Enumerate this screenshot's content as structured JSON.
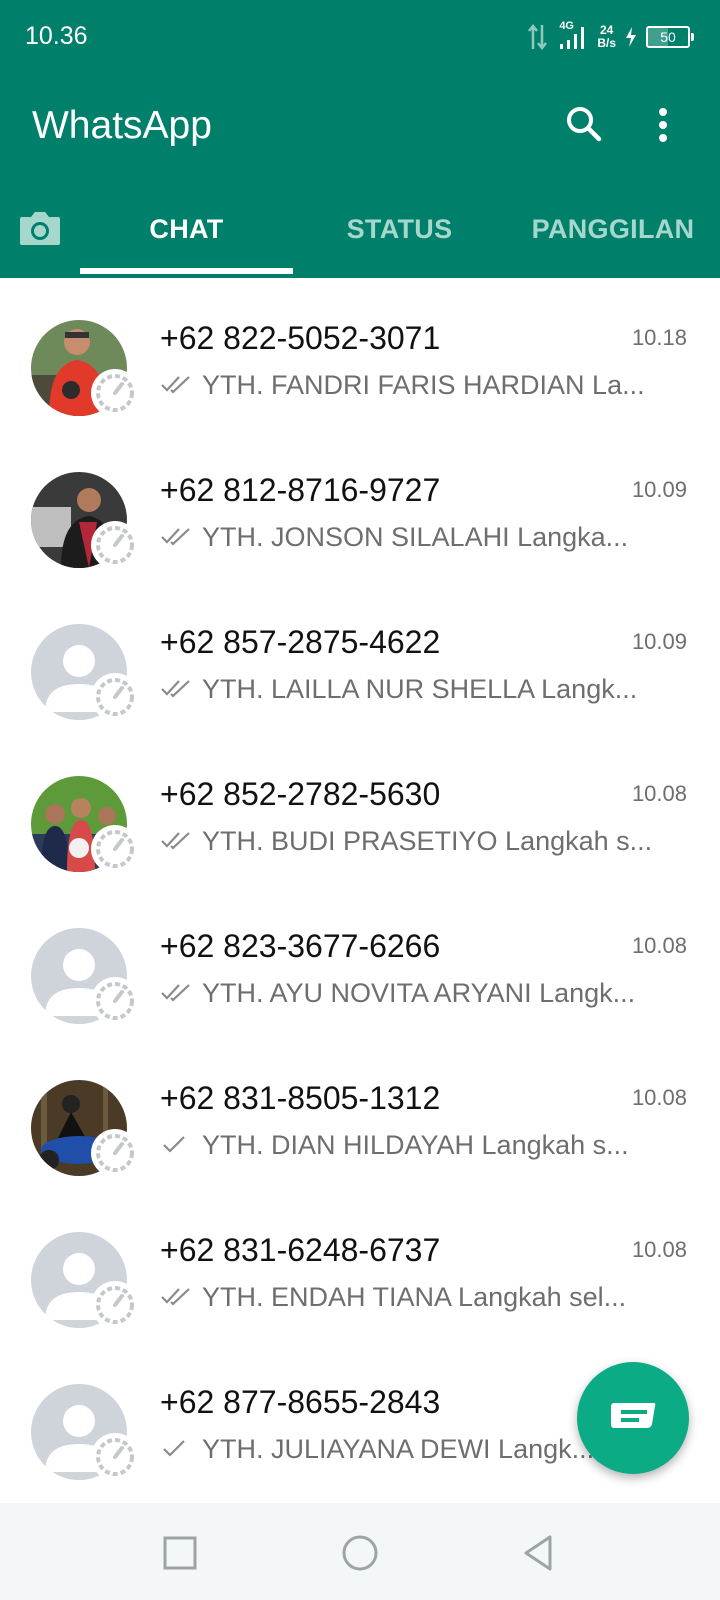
{
  "status_bar": {
    "time": "10.36",
    "network": "4G",
    "net_speed_value": "24",
    "net_speed_unit": "B/s",
    "battery": "50"
  },
  "app_bar": {
    "title": "WhatsApp",
    "search_icon": "search-icon",
    "menu_icon": "more-vert-icon"
  },
  "tabs": [
    {
      "label": "CHAT",
      "active": true
    },
    {
      "label": "STATUS",
      "active": false
    },
    {
      "label": "PANGGILAN",
      "active": false
    }
  ],
  "chats": [
    {
      "name": "+62 822-5052-3071",
      "time": "10.18",
      "tick": "double",
      "preview": "YTH. FANDRI FARIS HARDIAN  La..."
    },
    {
      "name": "+62 812-8716-9727",
      "time": "10.09",
      "tick": "double",
      "preview": "YTH. JONSON SILALAHI  Langka..."
    },
    {
      "name": "+62 857-2875-4622",
      "time": "10.09",
      "tick": "double",
      "preview": "YTH. LAILLA NUR SHELLA  Langk..."
    },
    {
      "name": "+62 852-2782-5630",
      "time": "10.08",
      "tick": "double",
      "preview": "YTH. BUDI PRASETIYO  Langkah s..."
    },
    {
      "name": "+62 823-3677-6266",
      "time": "10.08",
      "tick": "double",
      "preview": "YTH. AYU NOVITA ARYANI  Langk..."
    },
    {
      "name": "+62 831-8505-1312",
      "time": "10.08",
      "tick": "single",
      "preview": "YTH. DIAN HILDAYAH  Langkah s..."
    },
    {
      "name": "+62 831-6248-6737",
      "time": "10.08",
      "tick": "double",
      "preview": "YTH. ENDAH TIANA  Langkah sel..."
    },
    {
      "name": "+62 877-8655-2843",
      "time": "",
      "tick": "single",
      "preview": "YTH. JULIAYANA DEWI  Langk..."
    }
  ],
  "colors": {
    "header": "#00806b",
    "fab": "#0bab85",
    "tab_inactive": "#a6d7cd"
  },
  "fab_icon": "new-chat-icon"
}
